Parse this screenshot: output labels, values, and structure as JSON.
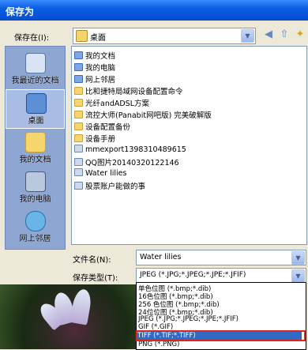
{
  "window": {
    "title": "保存为"
  },
  "lookin": {
    "label": "保存在(I):",
    "value": "桌面"
  },
  "places": [
    {
      "label": "我最近的文档",
      "icon": "recent-documents-icon"
    },
    {
      "label": "桌面",
      "icon": "desktop-icon"
    },
    {
      "label": "我的文档",
      "icon": "my-documents-icon"
    },
    {
      "label": "我的电脑",
      "icon": "my-computer-icon"
    },
    {
      "label": "网上邻居",
      "icon": "network-places-icon"
    }
  ],
  "files": [
    {
      "name": "我的文档",
      "type": "special"
    },
    {
      "name": "我的电脑",
      "type": "special"
    },
    {
      "name": "网上邻居",
      "type": "special"
    },
    {
      "name": "比和捷特局域网设备配置命令",
      "type": "folder"
    },
    {
      "name": "光纤andADSL方案",
      "type": "folder"
    },
    {
      "name": "流控大师(Panabit网吧版) 完美破解版",
      "type": "folder"
    },
    {
      "name": "设备配置备份",
      "type": "folder"
    },
    {
      "name": "设备手册",
      "type": "folder"
    },
    {
      "name": "mmexport1398310489615",
      "type": "image"
    },
    {
      "name": "QQ图片20140320122146",
      "type": "image"
    },
    {
      "name": "Water lilies",
      "type": "image"
    },
    {
      "name": "股票账户能做的事",
      "type": "image"
    }
  ],
  "filename": {
    "label": "文件名(N):",
    "value": "Water lilies"
  },
  "filetype": {
    "label": "保存类型(T):",
    "value": "JPEG (*.JPG;*.JPEG;*.JPE;*.JFIF)",
    "options": [
      "单色位图 (*.bmp;*.dib)",
      "16色位图 (*.bmp;*.dib)",
      "256 色位图 (*.bmp;*.dib)",
      "24位位图 (*.bmp;*.dib)",
      "JPEG (*.JPG;*.JPEG;*.JPE;*.JFIF)",
      "GIF (*.GIF)",
      "TIFF (*.TIF;*.TIFF)",
      "PNG (*.PNG)"
    ],
    "selected_index": 6
  },
  "colors": {
    "title_bar": "#0a5ee0",
    "selection": "#316ac5",
    "highlight_box": "#e0241a"
  }
}
